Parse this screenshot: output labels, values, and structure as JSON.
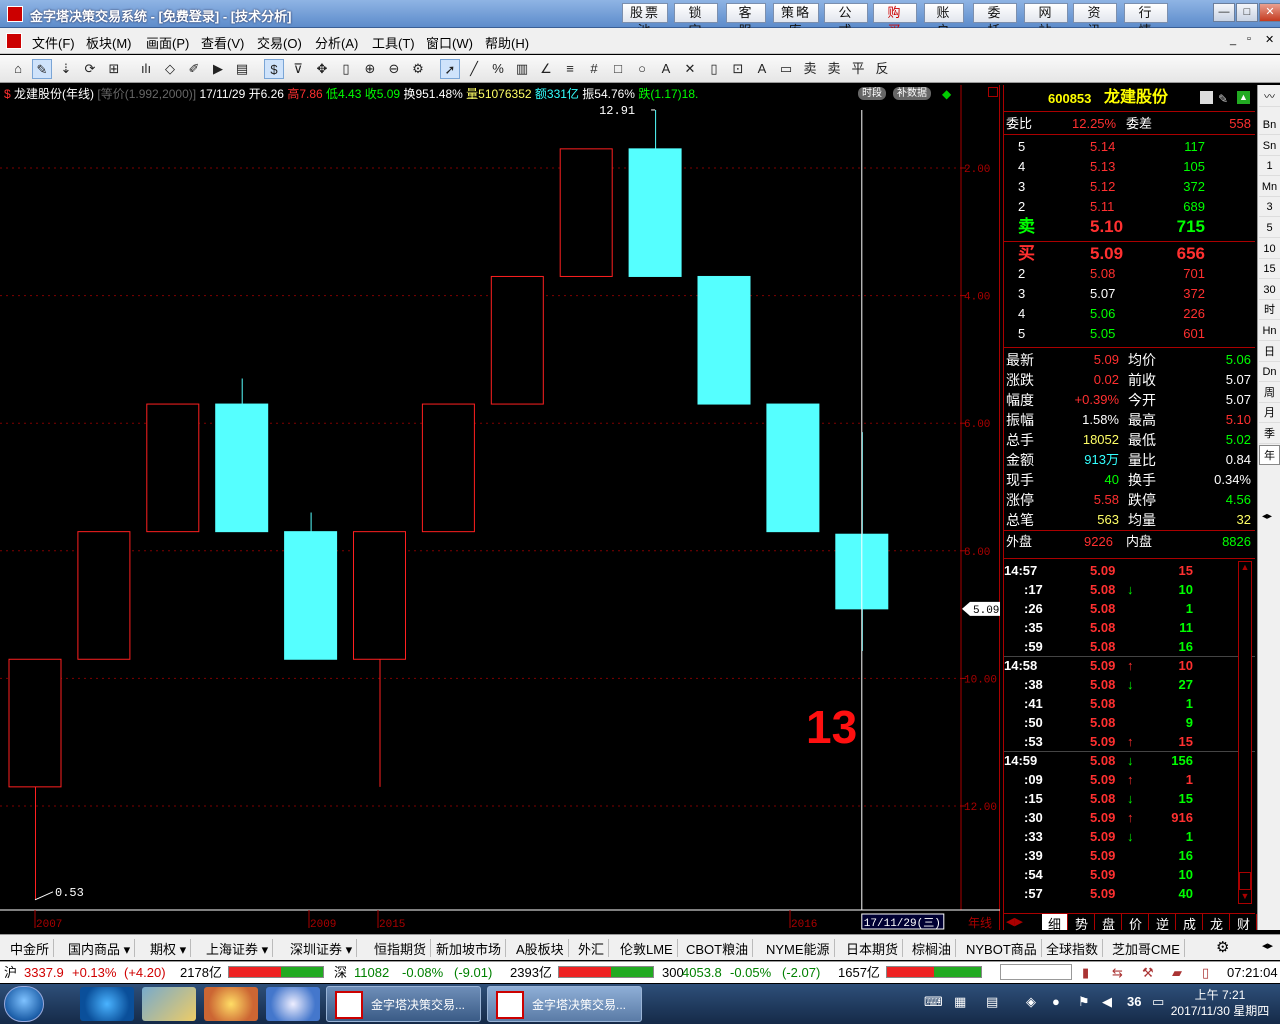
{
  "window": {
    "title": "金字塔决策交易系统 - [免费登录] - [技术分析]",
    "top_buttons": [
      "股票池",
      "锁 定",
      "客 服",
      "策略库",
      "公 式",
      "购 买",
      "账 户",
      "委 托",
      "网 站",
      "资 讯",
      "行 情"
    ],
    "win_controls": [
      "—",
      "□",
      "✕"
    ]
  },
  "menu": [
    "文件(F)",
    "板块(M)",
    "画面(P)",
    "查看(V)",
    "交易(O)",
    "分析(A)",
    "工具(T)",
    "窗口(W)",
    "帮助(H)"
  ],
  "chart": {
    "info": {
      "name": "龙建股份(年线)",
      "mode": "[等价(1.992,2000)]",
      "date": "17/11/29",
      "open": "开6.26",
      "high": "高7.86",
      "low": "低4.43",
      "close": "收5.09",
      "turnover": "换951.48%",
      "volume": "量51076352",
      "amount": "额331亿",
      "amplitude": "振54.76%",
      "change": "跌(1.17)18.",
      "btn_period": "时段",
      "btn_fill": "补数据"
    },
    "current_price_label": "5.09",
    "high_label": "12.91",
    "low_label": "0.53",
    "big_number": "13",
    "cursor_date": "17/11/29(三)",
    "axis_mode": "年线",
    "x_labels": [
      "2007",
      "2009",
      "2015",
      "2016"
    ],
    "y_ticks": [
      "12.00",
      "10.00",
      "8.00",
      "6.00",
      "4.00",
      "2.00"
    ]
  },
  "chart_data": {
    "type": "candlestick",
    "period": "年线",
    "ylim": [
      0.53,
      12.91
    ],
    "y_ticks": [
      2,
      4,
      6,
      8,
      10,
      12
    ],
    "candles": [
      {
        "open": 2.3,
        "close": 4.3,
        "high": 4.3,
        "low": 0.53,
        "color": "red"
      },
      {
        "open": 4.3,
        "close": 6.3,
        "high": 6.3,
        "low": 4.3,
        "color": "red"
      },
      {
        "open": 6.3,
        "close": 8.3,
        "high": 8.3,
        "low": 6.3,
        "color": "red"
      },
      {
        "open": 8.3,
        "close": 6.3,
        "high": 8.7,
        "low": 6.3,
        "color": "cyan"
      },
      {
        "open": 6.3,
        "close": 4.3,
        "high": 6.6,
        "low": 4.3,
        "color": "cyan"
      },
      {
        "open": 4.3,
        "close": 6.3,
        "high": 6.3,
        "low": 2.3,
        "color": "red"
      },
      {
        "open": 6.3,
        "close": 8.3,
        "high": 8.3,
        "low": 6.3,
        "color": "red"
      },
      {
        "open": 8.3,
        "close": 10.3,
        "high": 10.3,
        "low": 8.3,
        "color": "red"
      },
      {
        "open": 10.3,
        "close": 12.3,
        "high": 12.3,
        "low": 10.3,
        "color": "red"
      },
      {
        "open": 12.3,
        "close": 10.3,
        "high": 12.91,
        "low": 10.3,
        "color": "cyan"
      },
      {
        "open": 10.3,
        "close": 8.3,
        "high": 10.3,
        "low": 8.3,
        "color": "cyan"
      },
      {
        "open": 8.3,
        "close": 6.3,
        "high": 8.3,
        "low": 6.3,
        "color": "cyan"
      },
      {
        "open": 6.26,
        "close": 5.09,
        "high": 7.86,
        "low": 4.43,
        "color": "cyan"
      }
    ]
  },
  "quote": {
    "code": "600853",
    "name": "龙建股份",
    "weibi_label": "委比",
    "weibi": "12.25%",
    "weicha_label": "委差",
    "weicha": "558",
    "sell": [
      {
        "lvl": "5",
        "price": "5.14",
        "vol": "117"
      },
      {
        "lvl": "4",
        "price": "5.13",
        "vol": "105"
      },
      {
        "lvl": "3",
        "price": "5.12",
        "vol": "372"
      },
      {
        "lvl": "2",
        "price": "5.11",
        "vol": "689"
      },
      {
        "lvl": "卖",
        "price": "5.10",
        "vol": "715"
      }
    ],
    "buy": [
      {
        "lvl": "买",
        "price": "5.09",
        "vol": "656"
      },
      {
        "lvl": "2",
        "price": "5.08",
        "vol": "701"
      },
      {
        "lvl": "3",
        "price": "5.07",
        "vol": "372"
      },
      {
        "lvl": "4",
        "price": "5.06",
        "vol": "226"
      },
      {
        "lvl": "5",
        "price": "5.05",
        "vol": "601"
      }
    ],
    "stats": [
      {
        "l1": "最新",
        "v1": "5.09",
        "c1": "#ff3030",
        "l2": "均价",
        "v2": "5.06",
        "c2": "#00ff00"
      },
      {
        "l1": "涨跌",
        "v1": "0.02",
        "c1": "#ff3030",
        "l2": "前收",
        "v2": "5.07",
        "c2": "#ffffff"
      },
      {
        "l1": "幅度",
        "v1": "+0.39%",
        "c1": "#ff3030",
        "l2": "今开",
        "v2": "5.07",
        "c2": "#ffffff"
      },
      {
        "l1": "振幅",
        "v1": "1.58%",
        "c1": "#ffffff",
        "l2": "最高",
        "v2": "5.10",
        "c2": "#ff3030"
      },
      {
        "l1": "总手",
        "v1": "18052",
        "c1": "#ffff66",
        "l2": "最低",
        "v2": "5.02",
        "c2": "#00ff00"
      },
      {
        "l1": "金额",
        "v1": "913万",
        "c1": "#33ffff",
        "l2": "量比",
        "v2": "0.84",
        "c2": "#ffffff"
      },
      {
        "l1": "现手",
        "v1": "40",
        "c1": "#00ff00",
        "l2": "换手",
        "v2": "0.34%",
        "c2": "#ffffff"
      },
      {
        "l1": "涨停",
        "v1": "5.58",
        "c1": "#ff3030",
        "l2": "跌停",
        "v2": "4.56",
        "c2": "#00ff00"
      },
      {
        "l1": "总笔",
        "v1": "563",
        "c1": "#ffff66",
        "l2": "均量",
        "v2": "32",
        "c2": "#ffff66"
      }
    ],
    "outer_label": "外盘",
    "outer": "9226",
    "inner_label": "内盘",
    "inner": "8826",
    "ticks": [
      {
        "t": "14:57",
        "p": "5.09",
        "a": "",
        "v": "15",
        "pc": "#ff3030",
        "vc": "#ff3030"
      },
      {
        "t": ":17",
        "p": "5.08",
        "a": "↓",
        "v": "10",
        "pc": "#ff3030",
        "vc": "#00ff00"
      },
      {
        "t": ":26",
        "p": "5.08",
        "a": "",
        "v": "1",
        "pc": "#ff3030",
        "vc": "#00ff00"
      },
      {
        "t": ":35",
        "p": "5.08",
        "a": "",
        "v": "11",
        "pc": "#ff3030",
        "vc": "#00ff00"
      },
      {
        "t": ":59",
        "p": "5.08",
        "a": "",
        "v": "16",
        "pc": "#ff3030",
        "vc": "#00ff00"
      },
      {
        "t": "14:58",
        "p": "5.09",
        "a": "↑",
        "v": "10",
        "pc": "#ff3030",
        "vc": "#ff3030"
      },
      {
        "t": ":38",
        "p": "5.08",
        "a": "↓",
        "v": "27",
        "pc": "#ff3030",
        "vc": "#00ff00"
      },
      {
        "t": ":41",
        "p": "5.08",
        "a": "",
        "v": "1",
        "pc": "#ff3030",
        "vc": "#00ff00"
      },
      {
        "t": ":50",
        "p": "5.08",
        "a": "",
        "v": "9",
        "pc": "#ff3030",
        "vc": "#00ff00"
      },
      {
        "t": ":53",
        "p": "5.09",
        "a": "↑",
        "v": "15",
        "pc": "#ff3030",
        "vc": "#ff3030"
      },
      {
        "t": "14:59",
        "p": "5.08",
        "a": "↓",
        "v": "156",
        "pc": "#ff3030",
        "vc": "#00ff00"
      },
      {
        "t": ":09",
        "p": "5.09",
        "a": "↑",
        "v": "1",
        "pc": "#ff3030",
        "vc": "#ff3030"
      },
      {
        "t": ":15",
        "p": "5.08",
        "a": "↓",
        "v": "15",
        "pc": "#ff3030",
        "vc": "#00ff00"
      },
      {
        "t": ":30",
        "p": "5.09",
        "a": "↑",
        "v": "916",
        "pc": "#ff3030",
        "vc": "#ff3030"
      },
      {
        "t": ":33",
        "p": "5.09",
        "a": "↓",
        "v": "1",
        "pc": "#ff3030",
        "vc": "#00ff00"
      },
      {
        "t": ":39",
        "p": "5.09",
        "a": "",
        "v": "16",
        "pc": "#ff3030",
        "vc": "#00ff00"
      },
      {
        "t": ":54",
        "p": "5.09",
        "a": "",
        "v": "10",
        "pc": "#ff3030",
        "vc": "#00ff00"
      },
      {
        "t": ":57",
        "p": "5.09",
        "a": "",
        "v": "40",
        "pc": "#ff3030",
        "vc": "#00ff00"
      }
    ],
    "bottom_tabs": [
      "细",
      "势",
      "盘",
      "价",
      "逆",
      "成",
      "龙",
      "财"
    ]
  },
  "side_tabs": [
    "分",
    "Bn",
    "Sn",
    "1",
    "Mn",
    "3",
    "5",
    "10",
    "15",
    "30",
    "时",
    "Hn",
    "日",
    "Dn",
    "周",
    "月",
    "季",
    "年"
  ],
  "market_tabs": [
    "中金所",
    "国内商品 ▾",
    "期权 ▾",
    "上海证券 ▾",
    "深圳证券 ▾",
    "恒指期货",
    "新加坡市场",
    "A股板块",
    "外汇",
    "伦敦LME",
    "CBOT粮油",
    "NYME能源",
    "日本期货",
    "棕榈油",
    "NYBOT商品",
    "全球指数",
    "芝加哥CME"
  ],
  "indexes": [
    {
      "name": "沪",
      "price": "3337.9",
      "pct": "+0.13%",
      "chg": "(+4.20)",
      "amt": "2178亿",
      "color": "#d00000",
      "red": 0.55
    },
    {
      "name": "深",
      "price": "11082",
      "pct": "-0.08%",
      "chg": "(-9.01)",
      "amt": "2393亿",
      "color": "#008000",
      "red": 0.55
    },
    {
      "name": "300",
      "price": "4053.8",
      "pct": "-0.05%",
      "chg": "(-2.07)",
      "amt": "1657亿",
      "color": "#008000",
      "red": 0.5
    }
  ],
  "status_time": "07:21:04",
  "taskbar": {
    "tasks": [
      "金字塔决策交易...",
      "金字塔决策交易..."
    ],
    "tray_num": "36",
    "clock_time": "上午 7:21",
    "clock_date": "2017/11/30 星期四"
  },
  "colors": {
    "up": "#ff3030",
    "down": "#00ff00",
    "cyan_candle": "#55ffff",
    "grid": "#800000"
  }
}
